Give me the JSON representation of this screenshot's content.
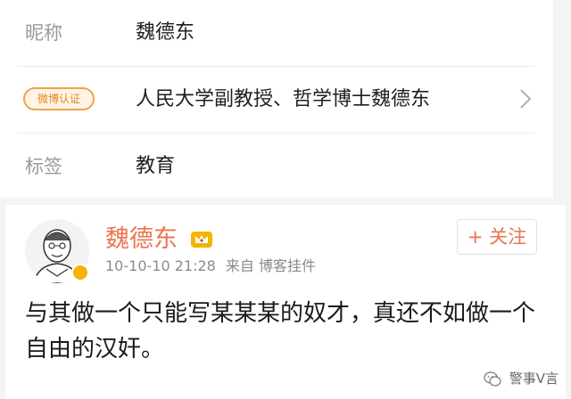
{
  "profile": {
    "nickname_label": "昵称",
    "nickname_value": "魏德东",
    "verified_badge": "微博认证",
    "verified_value": "人民大学副教授、哲学博士魏德东",
    "tags_label": "标签",
    "tags_value": "教育"
  },
  "post": {
    "author": "魏德东",
    "timestamp": "10-10-10 21:28",
    "source": "来自 博客挂件",
    "follow_label": "+ 关注",
    "body": "与其做一个只能写某某某的奴才，真还不如做一个自由的汉奸。"
  },
  "watermark": {
    "text": "警事V言"
  },
  "colors": {
    "accent": "#eb7350",
    "badge_border": "#f0a34a",
    "badge_text": "#e9831e",
    "verified_badge": "#f5b400",
    "label_gray": "#9a9a9a"
  },
  "icons": [
    "chevron-right-icon",
    "crown-icon",
    "verified-v-icon",
    "wechat-icon"
  ]
}
